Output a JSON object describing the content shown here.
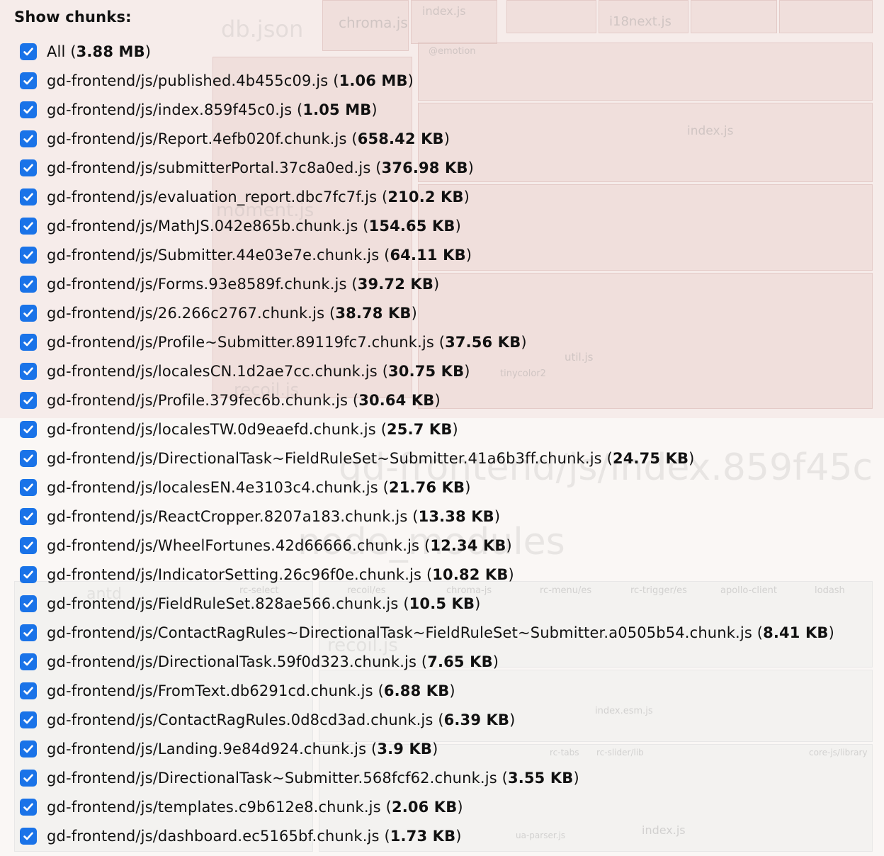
{
  "panel": {
    "title": "Show chunks:",
    "items": [
      {
        "name": "All",
        "size": "3.88 MB",
        "checked": true
      },
      {
        "name": "gd-frontend/js/published.4b455c09.js",
        "size": "1.06 MB",
        "checked": true
      },
      {
        "name": "gd-frontend/js/index.859f45c0.js",
        "size": "1.05 MB",
        "checked": true
      },
      {
        "name": "gd-frontend/js/Report.4efb020f.chunk.js",
        "size": "658.42 KB",
        "checked": true
      },
      {
        "name": "gd-frontend/js/submitterPortal.37c8a0ed.js",
        "size": "376.98 KB",
        "checked": true
      },
      {
        "name": "gd-frontend/js/evaluation_report.dbc7fc7f.js",
        "size": "210.2 KB",
        "checked": true
      },
      {
        "name": "gd-frontend/js/MathJS.042e865b.chunk.js",
        "size": "154.65 KB",
        "checked": true
      },
      {
        "name": "gd-frontend/js/Submitter.44e03e7e.chunk.js",
        "size": "64.11 KB",
        "checked": true
      },
      {
        "name": "gd-frontend/js/Forms.93e8589f.chunk.js",
        "size": "39.72 KB",
        "checked": true
      },
      {
        "name": "gd-frontend/js/26.266c2767.chunk.js",
        "size": "38.78 KB",
        "checked": true
      },
      {
        "name": "gd-frontend/js/Profile~Submitter.89119fc7.chunk.js",
        "size": "37.56 KB",
        "checked": true
      },
      {
        "name": "gd-frontend/js/localesCN.1d2ae7cc.chunk.js",
        "size": "30.75 KB",
        "checked": true
      },
      {
        "name": "gd-frontend/js/Profile.379fec6b.chunk.js",
        "size": "30.64 KB",
        "checked": true
      },
      {
        "name": "gd-frontend/js/localesTW.0d9eaefd.chunk.js",
        "size": "25.7 KB",
        "checked": true
      },
      {
        "name": "gd-frontend/js/DirectionalTask~FieldRuleSet~Submitter.41a6b3ff.chunk.js",
        "size": "24.75 KB",
        "checked": true
      },
      {
        "name": "gd-frontend/js/localesEN.4e3103c4.chunk.js",
        "size": "21.76 KB",
        "checked": true
      },
      {
        "name": "gd-frontend/js/ReactCropper.8207a183.chunk.js",
        "size": "13.38 KB",
        "checked": true
      },
      {
        "name": "gd-frontend/js/WheelFortunes.42d66666.chunk.js",
        "size": "12.34 KB",
        "checked": true
      },
      {
        "name": "gd-frontend/js/IndicatorSetting.26c96f0e.chunk.js",
        "size": "10.82 KB",
        "checked": true
      },
      {
        "name": "gd-frontend/js/FieldRuleSet.828ae566.chunk.js",
        "size": "10.5 KB",
        "checked": true
      },
      {
        "name": "gd-frontend/js/ContactRagRules~DirectionalTask~FieldRuleSet~Submitter.a0505b54.chunk.js",
        "size": "8.41 KB",
        "checked": true
      },
      {
        "name": "gd-frontend/js/DirectionalTask.59f0d323.chunk.js",
        "size": "7.65 KB",
        "checked": true
      },
      {
        "name": "gd-frontend/js/FromText.db6291cd.chunk.js",
        "size": "6.88 KB",
        "checked": true
      },
      {
        "name": "gd-frontend/js/ContactRagRules.0d8cd3ad.chunk.js",
        "size": "6.39 KB",
        "checked": true
      },
      {
        "name": "gd-frontend/js/Landing.9e84d924.chunk.js",
        "size": "3.9 KB",
        "checked": true
      },
      {
        "name": "gd-frontend/js/DirectionalTask~Submitter.568fcf62.chunk.js",
        "size": "3.55 KB",
        "checked": true
      },
      {
        "name": "gd-frontend/js/templates.c9b612e8.chunk.js",
        "size": "2.06 KB",
        "checked": true
      },
      {
        "name": "gd-frontend/js/dashboard.ec5165bf.chunk.js",
        "size": "1.73 KB",
        "checked": true
      }
    ]
  },
  "background_labels": {
    "db_json": "db.json",
    "chroma_js": "chroma.js",
    "index_js": "index.js",
    "i18next_js": "i18next.js",
    "emotion": "@emotion",
    "moment_js": "moment.js",
    "recoil_js": "recoil.js",
    "util_js": "util.js",
    "tinycolor2": "tinycolor2",
    "big_title": "gd-frontend/js/index.859f45c",
    "node_modules": "node_modules",
    "antd": "antd",
    "rc_select": "rc-select",
    "recoil_es": "recoil/es",
    "chroma_js2": "chroma-js",
    "rc_menu_es": "rc-menu/es",
    "rc_trigger_es": "rc-trigger/es",
    "apollo_client": "apollo-client",
    "lodash": "lodash",
    "recoil_js2": "recoil.js",
    "index_esm_js": "index.esm.js",
    "rc_tabs": "rc-tabs",
    "rc_slider_lib": "rc-slider/lib",
    "core_js_library": "core-js/library",
    "ua_parser_js": "ua-parser.js"
  },
  "colors": {
    "checkbox": "#1a73e8",
    "text": "#111111"
  }
}
